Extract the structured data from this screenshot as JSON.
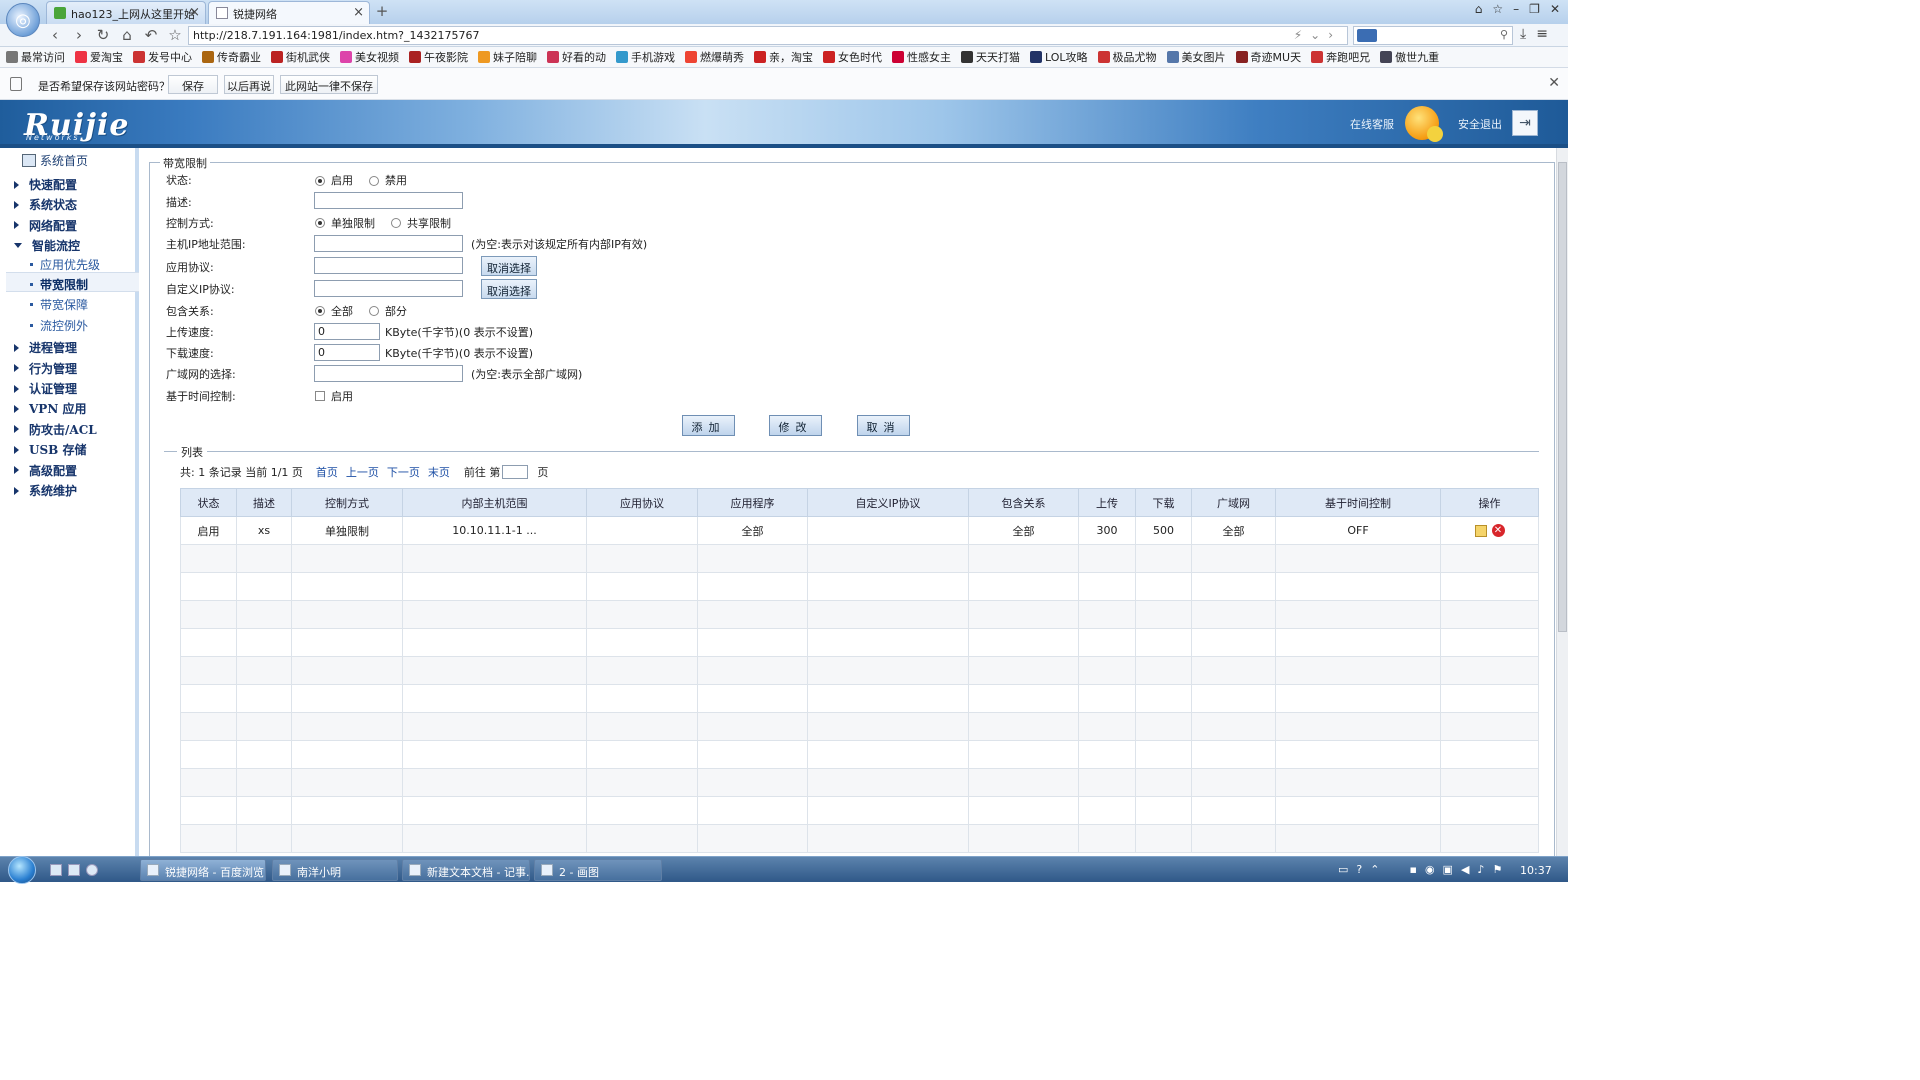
{
  "browser": {
    "tabs": [
      {
        "title": "hao123_上网从这里开始",
        "active": false
      },
      {
        "title": "锐捷网络",
        "active": true
      }
    ],
    "url": "http://218.7.191.164:1981/index.htm?_1432175767",
    "bookmarks": [
      "最常访问",
      "爱淘宝",
      "发号中心",
      "传奇霸业",
      "街机武侠",
      "美女视频",
      "午夜影院",
      "妹子陪聊",
      "好看的动",
      "手机游戏",
      "燃爆萌秀",
      "亲，淘宝",
      "女色时代",
      "性感女主",
      "天天打猫",
      "LOL攻略",
      "极品尤物",
      "美女图片",
      "奇迹MU天",
      "奔跑吧兄",
      "傲世九重"
    ]
  },
  "password_bar": {
    "question": "是否希望保存该网站密码？",
    "save": "保存",
    "later": "以后再说",
    "never": "此网站一律不保存"
  },
  "header": {
    "logo": "Ruijie",
    "logo_sub": "Networks",
    "online_service": "在线客服",
    "logout": "安全退出"
  },
  "sidebar": {
    "home": "系统首页",
    "groups": [
      {
        "label": "快速配置"
      },
      {
        "label": "系统状态"
      },
      {
        "label": "网络配置"
      },
      {
        "label": "智能流控",
        "open": true,
        "items": [
          "应用优先级",
          "带宽限制",
          "带宽保障",
          "流控例外"
        ],
        "active": "带宽限制"
      },
      {
        "label": "进程管理"
      },
      {
        "label": "行为管理"
      },
      {
        "label": "认证管理"
      },
      {
        "label": "VPN 应用"
      },
      {
        "label": "防攻击/ACL"
      },
      {
        "label": "USB 存储"
      },
      {
        "label": "高级配置"
      },
      {
        "label": "系统维护"
      }
    ]
  },
  "form": {
    "legend": "带宽限制",
    "status": {
      "label": "状态:",
      "enable": "启用",
      "disable": "禁用",
      "selected": "启用"
    },
    "desc": {
      "label": "描述:",
      "value": ""
    },
    "control": {
      "label": "控制方式:",
      "single": "单独限制",
      "shared": "共享限制",
      "selected": "单独限制"
    },
    "ip_range": {
      "label": "主机IP地址范围:",
      "value": "",
      "hint": "(为空:表示对该规定所有内部IP有效)"
    },
    "app_protocol": {
      "label": "应用协议:",
      "value": "",
      "button": "取消选择"
    },
    "custom_ip": {
      "label": "自定义IP协议:",
      "value": "",
      "button": "取消选择"
    },
    "include": {
      "label": "包含关系:",
      "all": "全部",
      "part": "部分",
      "selected": "全部"
    },
    "upload": {
      "label": "上传速度:",
      "value": "0",
      "hint": "KByte(千字节)(0 表示不设置)"
    },
    "download": {
      "label": "下载速度:",
      "value": "0",
      "hint": "KByte(千字节)(0 表示不设置)"
    },
    "wan": {
      "label": "广域网的选择:",
      "value": "",
      "hint": "(为空:表示全部广域网)"
    },
    "time_control": {
      "label": "基于时间控制:",
      "option": "启用",
      "checked": false
    },
    "buttons": {
      "add": "添加",
      "modify": "修改",
      "cancel": "取消"
    }
  },
  "list": {
    "legend": "列表",
    "pager": {
      "summary": "共: 1 条记录 当前 1/1 页",
      "first": "首页",
      "prev": "上一页",
      "next": "下一页",
      "last": "末页",
      "goto_prefix": "前往 第",
      "goto_suffix": "页"
    },
    "columns": [
      "状态",
      "描述",
      "控制方式",
      "内部主机范围",
      "应用协议",
      "应用程序",
      "自定义IP协议",
      "包含关系",
      "上传",
      "下载",
      "广域网",
      "基于时间控制",
      "操作"
    ],
    "rows": [
      [
        "启用",
        "xs",
        "单独限制",
        "10.10.11.1-1 ...",
        "",
        "全部",
        "",
        "全部",
        "300",
        "500",
        "全部",
        "OFF",
        ""
      ]
    ],
    "empty_rows": 11
  },
  "taskbar": {
    "tasks": [
      "锐捷网络 - 百度浏览...",
      "南洋小明",
      "新建文本文档 - 记事...",
      "2 - 画图"
    ],
    "clock": "10:37"
  }
}
